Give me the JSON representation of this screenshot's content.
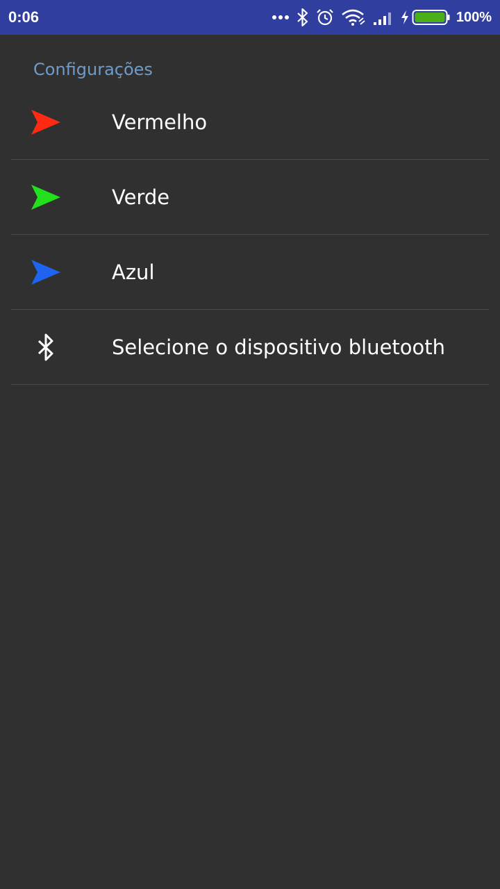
{
  "status_bar": {
    "time": "0:06",
    "icons": [
      "more-dots-icon",
      "bluetooth-icon",
      "alarm-icon",
      "wifi-icon",
      "signal-icon",
      "charging-icon",
      "battery-icon"
    ],
    "battery_percent": "100%",
    "battery_color": "#4caf1a"
  },
  "settings": {
    "title": "Configurações",
    "items": [
      {
        "label": "Vermelho",
        "icon": "send-icon",
        "icon_color": "#ff2a12"
      },
      {
        "label": "Verde",
        "icon": "send-icon",
        "icon_color": "#22e01c"
      },
      {
        "label": "Azul",
        "icon": "send-icon",
        "icon_color": "#1e64f0"
      },
      {
        "label": "Selecione o dispositivo bluetooth",
        "icon": "bluetooth-icon",
        "icon_color": "#ffffff"
      }
    ]
  },
  "colors": {
    "status_bar_bg": "#303f9f",
    "background": "#303030",
    "section_title": "#6f9bc8",
    "divider": "#4a4a4a"
  }
}
